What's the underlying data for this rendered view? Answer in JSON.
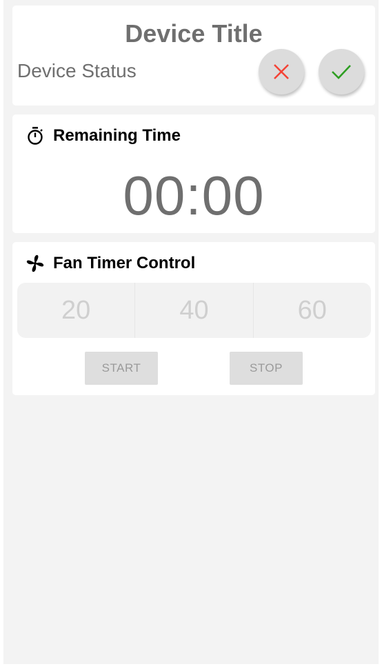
{
  "device": {
    "title": "Device Title",
    "status": "Device Status",
    "cancel_icon": "close-icon",
    "confirm_icon": "checkmark-icon",
    "cancel_color": "#f44336",
    "confirm_color": "#2e9e22"
  },
  "remaining": {
    "label": "Remaining Time",
    "icon": "stopwatch-icon",
    "value": "00:00"
  },
  "fan": {
    "label": "Fan Timer Control",
    "icon": "fan-icon",
    "options": [
      "20",
      "40",
      "60"
    ],
    "start_label": "START",
    "stop_label": "STOP"
  }
}
